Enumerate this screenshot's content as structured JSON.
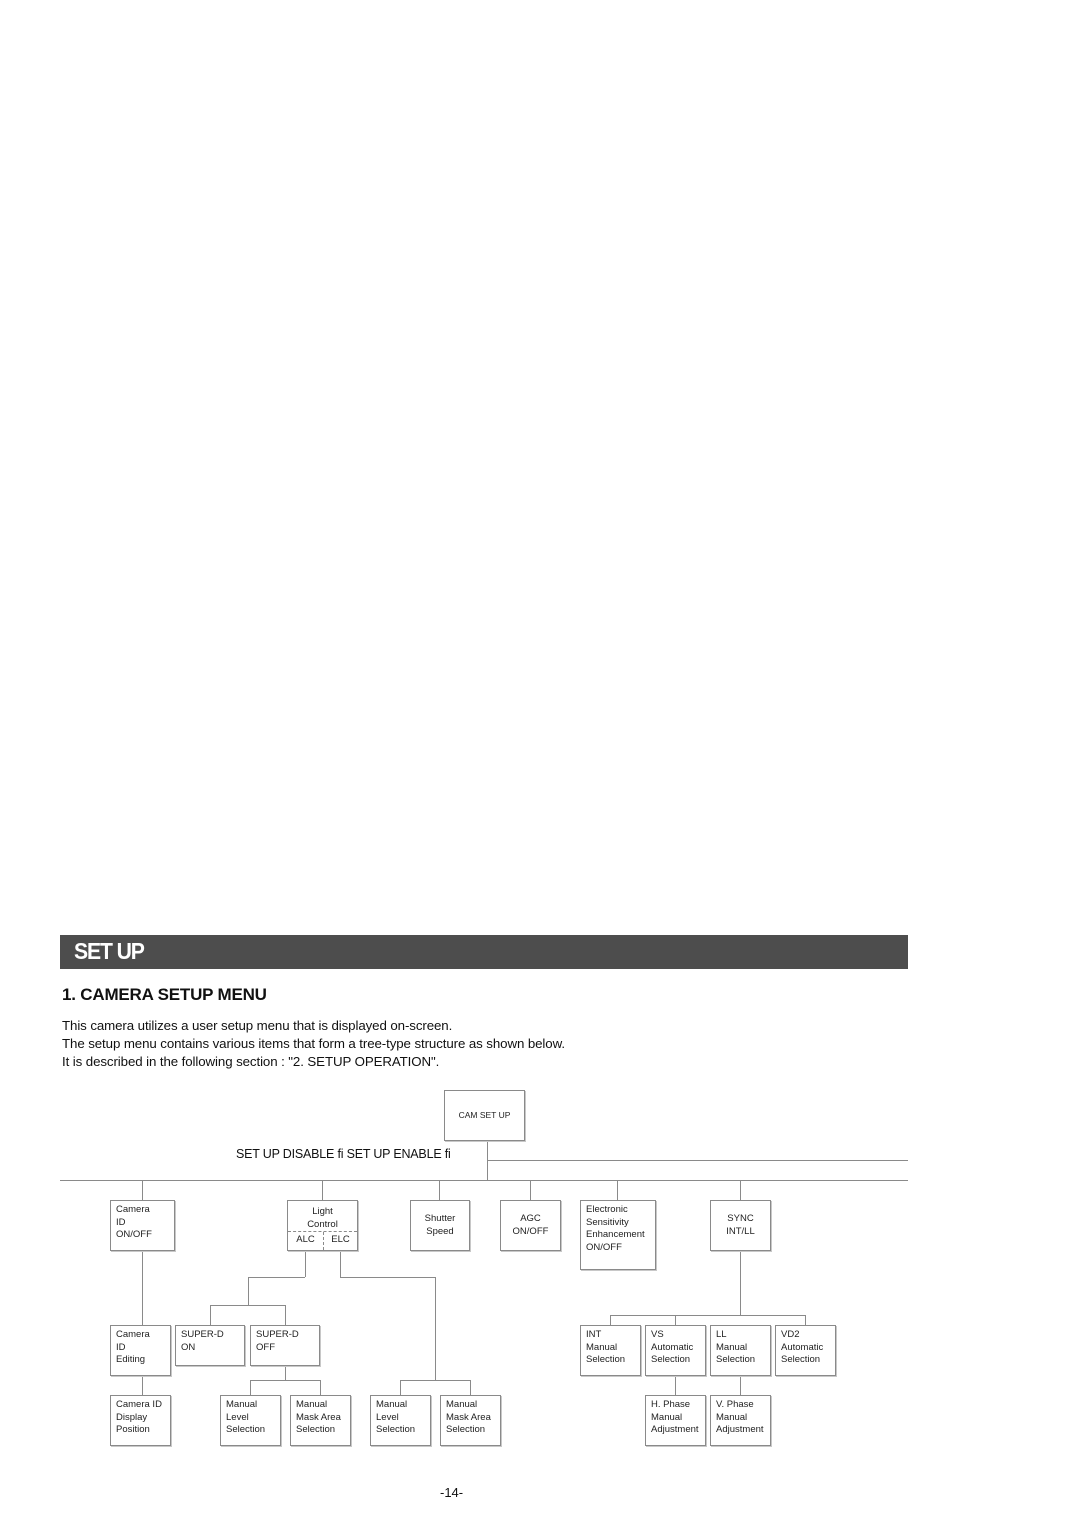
{
  "section_banner": "SET UP",
  "heading": "1. CAMERA SETUP MENU",
  "paragraphs": [
    "This camera utilizes a user setup menu that is displayed on-screen.",
    "The setup menu contains various items that form a tree-type structure as shown below.",
    "It is described in the following section : \"2. SETUP OPERATION\"."
  ],
  "tree": {
    "root": "CAM SET UP",
    "transition_label": "SET UP DISABLE fi   SET UP ENABLE fi",
    "level1": {
      "camera_id_onoff": [
        "Camera",
        "ID",
        "ON/OFF"
      ],
      "light_control": {
        "title": [
          "Light",
          "Control"
        ],
        "alc": "ALC",
        "elc": "ELC"
      },
      "shutter_speed": [
        "Shutter",
        "Speed"
      ],
      "agc": [
        "AGC",
        "ON/OFF"
      ],
      "electronic_sensitivity": [
        "Electronic",
        "Sensitivity",
        "Enhancement",
        "ON/OFF"
      ],
      "sync": [
        "SYNC",
        "INT/LL"
      ]
    },
    "level2": {
      "camera_id_editing": [
        "Camera",
        "ID",
        "Editing"
      ],
      "super_d_on": [
        "SUPER-D",
        "ON"
      ],
      "super_d_off": [
        "SUPER-D",
        "OFF"
      ],
      "int": [
        "INT",
        "Manual",
        "Selection"
      ],
      "vs": [
        "VS",
        "Automatic",
        "Selection"
      ],
      "ll": [
        "LL",
        "Manual",
        "Selection"
      ],
      "vd2": [
        "VD2",
        "Automatic",
        "Selection"
      ]
    },
    "level3": {
      "camera_id_display_position": [
        "Camera ID",
        "Display",
        "Position"
      ],
      "alc_manual_level": [
        "Manual",
        "Level",
        "Selection"
      ],
      "alc_manual_mask": [
        "Manual",
        "Mask Area",
        "Selection"
      ],
      "elc_manual_level": [
        "Manual",
        "Level",
        "Selection"
      ],
      "elc_manual_mask": [
        "Manual",
        "Mask Area",
        "Selection"
      ],
      "h_phase": [
        "H. Phase",
        "Manual",
        "Adjustment"
      ],
      "v_phase": [
        "V. Phase",
        "Manual",
        "Adjustment"
      ]
    }
  },
  "page_number": "-14-"
}
